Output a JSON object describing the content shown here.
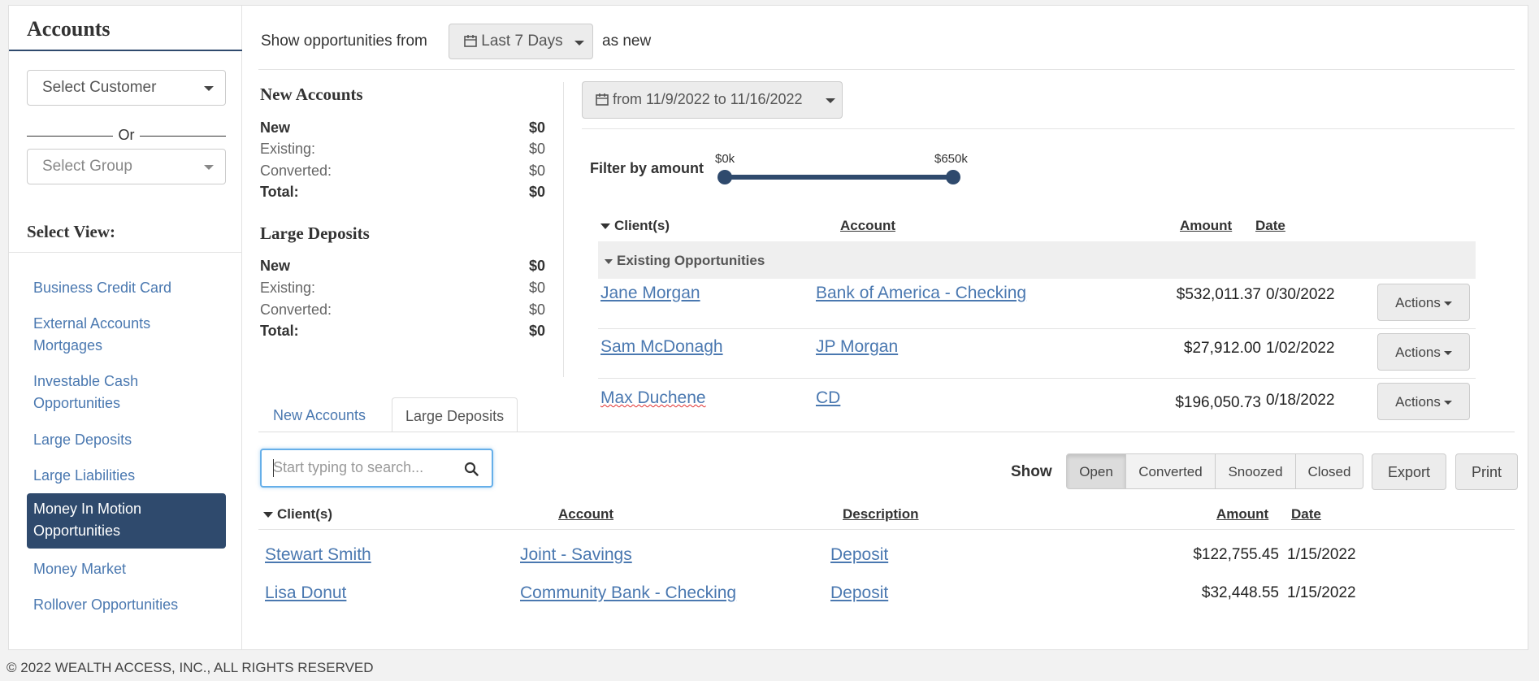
{
  "sidebar": {
    "title": "Accounts",
    "customer_select": "Select Customer",
    "or_label": "Or",
    "group_select": "Select Group",
    "select_view_label": "Select View:",
    "items": [
      {
        "label": "Business Credit Card"
      },
      {
        "label": "External Accounts Mortgages"
      },
      {
        "label": "Investable Cash Opportunities"
      },
      {
        "label": "Large Deposits"
      },
      {
        "label": "Large Liabilities"
      },
      {
        "label": "Money In Motion Opportunities",
        "active": true
      },
      {
        "label": "Money Market"
      },
      {
        "label": "Rollover Opportunities"
      }
    ]
  },
  "header": {
    "show_from_label": "Show opportunities from",
    "period": "Last 7 Days",
    "as_new_label": "as new"
  },
  "summary": {
    "new_accounts": {
      "title": "New Accounts",
      "rows": [
        {
          "label": "New",
          "value": "$0"
        },
        {
          "label": "Existing:",
          "value": "$0"
        },
        {
          "label": "Converted:",
          "value": "$0"
        },
        {
          "label": "Total:",
          "value": "$0"
        }
      ]
    },
    "large_deposits": {
      "title": "Large Deposits",
      "rows": [
        {
          "label": "New",
          "value": "$0"
        },
        {
          "label": "Existing:",
          "value": "$0"
        },
        {
          "label": "Converted:",
          "value": "$0"
        },
        {
          "label": "Total:",
          "value": "$0"
        }
      ]
    }
  },
  "range": {
    "label": "from 11/9/2022 to 11/16/2022"
  },
  "filter": {
    "label": "Filter by amount",
    "min_label": "$0k",
    "max_label": "$650k"
  },
  "top_table": {
    "headers": {
      "clients": "Client(s)",
      "account": "Account",
      "amount": "Amount",
      "date": "Date"
    },
    "group_label": "Existing Opportunities",
    "actions_label": "Actions",
    "rows": [
      {
        "client": "Jane Morgan",
        "account": "Bank of America - Checking",
        "amount": "$532,011.37",
        "date": "0/30/2022"
      },
      {
        "client": "Sam McDonagh",
        "account": "JP Morgan",
        "amount": "$27,912.00",
        "date": "1/02/2022"
      },
      {
        "client": "Max Duchene",
        "account": "CD",
        "amount": "$196,050.73",
        "date": "0/18/2022"
      }
    ]
  },
  "tabs": [
    {
      "label": "New Accounts"
    },
    {
      "label": "Large Deposits"
    }
  ],
  "search": {
    "placeholder": "Start typing to search..."
  },
  "show_label": "Show",
  "filters": [
    "Open",
    "Converted",
    "Snoozed",
    "Closed"
  ],
  "export_label": "Export",
  "print_label": "Print",
  "bottom_table": {
    "headers": {
      "clients": "Client(s)",
      "account": "Account",
      "description": "Description",
      "amount": "Amount",
      "date": "Date"
    },
    "rows": [
      {
        "client": "Stewart Smith",
        "account": "Joint - Savings",
        "description": "Deposit",
        "amount": "$122,755.45",
        "date": "1/15/2022"
      },
      {
        "client": "Lisa Donut",
        "account": "Community Bank - Checking",
        "description": "Deposit",
        "amount": "$32,448.55",
        "date": "1/15/2022"
      }
    ]
  },
  "footer": "© 2022 WEALTH ACCESS, INC., ALL RIGHTS RESERVED",
  "colors": {
    "accent": "#2f4a6d",
    "link": "#4a78b0"
  },
  "icons": {
    "calendar": "calendar-icon",
    "search": "search-icon"
  }
}
